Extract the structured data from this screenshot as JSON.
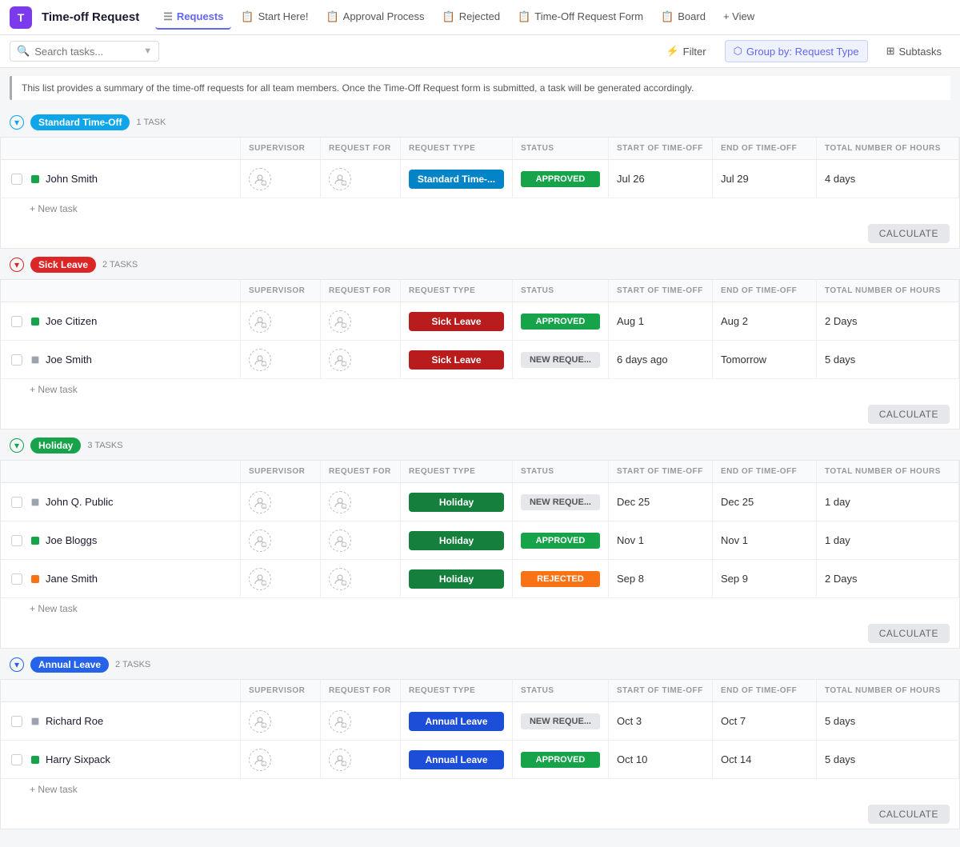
{
  "app": {
    "icon": "T",
    "title": "Time-off Request"
  },
  "nav": {
    "tabs": [
      {
        "id": "requests",
        "label": "Requests",
        "icon": "≡",
        "active": true
      },
      {
        "id": "start-here",
        "label": "Start Here!",
        "icon": "📋",
        "active": false
      },
      {
        "id": "approval-process",
        "label": "Approval Process",
        "icon": "📋",
        "active": false
      },
      {
        "id": "rejected",
        "label": "Rejected",
        "icon": "📋",
        "active": false
      },
      {
        "id": "timeoff-form",
        "label": "Time-Off Request Form",
        "icon": "📋",
        "active": false
      },
      {
        "id": "board",
        "label": "Board",
        "icon": "📋",
        "active": false
      }
    ],
    "view_label": "+ View"
  },
  "toolbar": {
    "search_placeholder": "Search tasks...",
    "filter_label": "Filter",
    "group_by_label": "Group by: Request Type",
    "subtasks_label": "Subtasks"
  },
  "info_banner": "This list provides a summary of the time-off requests for all team members. Once the Time-Off Request form is submitted, a task will be generated accordingly.",
  "columns": {
    "task": "",
    "supervisor": "SUPERVISOR",
    "request_for": "REQUEST FOR",
    "request_type": "REQUEST TYPE",
    "status": "STATUS",
    "start_of_timeoff": "START OF TIME-OFF",
    "end_of_timeoff": "END OF TIME-OFF",
    "total_hours": "TOTAL NUMBER OF HOURS"
  },
  "groups": [
    {
      "id": "standard",
      "label": "Standard Time-Off",
      "badge_class": "standard",
      "count": "1 TASK",
      "rows": [
        {
          "name": "John Smith",
          "status_dot": "green",
          "request_type": "Standard Time-...",
          "request_type_class": "standard",
          "status": "APPROVED",
          "status_class": "approved",
          "start": "Jul 26",
          "end": "Jul 29",
          "hours": "4 days"
        }
      ]
    },
    {
      "id": "sick",
      "label": "Sick Leave",
      "badge_class": "sick",
      "count": "2 TASKS",
      "rows": [
        {
          "name": "Joe Citizen",
          "status_dot": "green",
          "request_type": "Sick Leave",
          "request_type_class": "sick",
          "status": "APPROVED",
          "status_class": "approved",
          "start": "Aug 1",
          "end": "Aug 2",
          "hours": "2 Days"
        },
        {
          "name": "Joe Smith",
          "status_dot": "gray",
          "request_type": "Sick Leave",
          "request_type_class": "sick",
          "status": "NEW REQUE...",
          "status_class": "new-req",
          "start": "6 days ago",
          "end": "Tomorrow",
          "hours": "5 days"
        }
      ]
    },
    {
      "id": "holiday",
      "label": "Holiday",
      "badge_class": "holiday",
      "count": "3 TASKS",
      "rows": [
        {
          "name": "John Q. Public",
          "status_dot": "gray",
          "request_type": "Holiday",
          "request_type_class": "holiday",
          "status": "NEW REQUE...",
          "status_class": "new-req",
          "start": "Dec 25",
          "end": "Dec 25",
          "hours": "1 day"
        },
        {
          "name": "Joe Bloggs",
          "status_dot": "green",
          "request_type": "Holiday",
          "request_type_class": "holiday",
          "status": "APPROVED",
          "status_class": "approved",
          "start": "Nov 1",
          "end": "Nov 1",
          "hours": "1 day"
        },
        {
          "name": "Jane Smith",
          "status_dot": "orange",
          "request_type": "Holiday",
          "request_type_class": "holiday",
          "status": "REJECTED",
          "status_class": "rejected",
          "start": "Sep 8",
          "end": "Sep 9",
          "hours": "2 Days"
        }
      ]
    },
    {
      "id": "annual",
      "label": "Annual Leave",
      "badge_class": "annual",
      "count": "2 TASKS",
      "rows": [
        {
          "name": "Richard Roe",
          "status_dot": "gray",
          "request_type": "Annual Leave",
          "request_type_class": "annual",
          "status": "NEW REQUE...",
          "status_class": "new-req",
          "start": "Oct 3",
          "end": "Oct 7",
          "hours": "5 days"
        },
        {
          "name": "Harry Sixpack",
          "status_dot": "green",
          "request_type": "Annual Leave",
          "request_type_class": "annual",
          "status": "APPROVED",
          "status_class": "approved",
          "start": "Oct 10",
          "end": "Oct 14",
          "hours": "5 days"
        }
      ]
    }
  ],
  "labels": {
    "new_task": "+ New task",
    "calculate": "CALCULATE",
    "view_more": "+ View"
  }
}
